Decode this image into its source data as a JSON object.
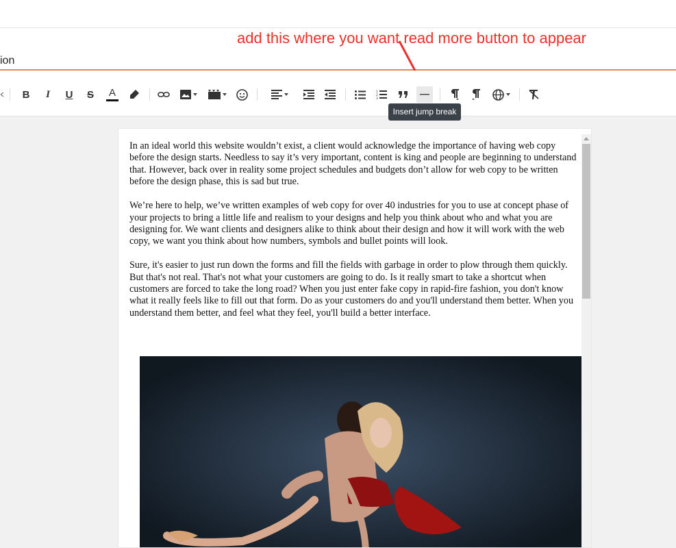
{
  "post": {
    "title_fragment": "ion"
  },
  "annotation": {
    "text": "add this where you want read more button to appear"
  },
  "toolbar": {
    "items": [
      {
        "name": "bold-icon",
        "label": "B"
      },
      {
        "name": "italic-icon",
        "label": "I"
      },
      {
        "name": "underline-icon",
        "label": "U"
      },
      {
        "name": "strikethrough-icon",
        "label": "S"
      },
      {
        "name": "text-color-icon",
        "label": "A"
      },
      {
        "name": "highlight-icon",
        "label": ""
      },
      {
        "name": "link-icon",
        "label": ""
      },
      {
        "name": "insert-image-icon",
        "label": ""
      },
      {
        "name": "insert-video-icon",
        "label": ""
      },
      {
        "name": "emoji-icon",
        "label": ""
      },
      {
        "name": "align-icon",
        "label": ""
      },
      {
        "name": "indent-icon",
        "label": ""
      },
      {
        "name": "outdent-icon",
        "label": ""
      },
      {
        "name": "bulleted-list-icon",
        "label": ""
      },
      {
        "name": "numbered-list-icon",
        "label": ""
      },
      {
        "name": "quote-icon",
        "label": ""
      },
      {
        "name": "jump-break-icon",
        "label": ""
      },
      {
        "name": "ltr-icon",
        "label": ""
      },
      {
        "name": "rtl-icon",
        "label": ""
      },
      {
        "name": "language-icon",
        "label": ""
      },
      {
        "name": "clear-formatting-icon",
        "label": ""
      }
    ],
    "tooltip": "Insert jump break"
  },
  "colors": {
    "annotation": "#e8322a",
    "title_underline": "#f0825a",
    "tooltip_bg": "#3b4148",
    "text_color_bar": "#111111"
  },
  "content": {
    "paragraphs": [
      "In an ideal world this website wouldn’t exist, a client would acknowledge the importance of having web copy before the design starts. Needless to say it’s very important, content is king and people are beginning to understand that. However, back over in reality some project schedules and budgets don’t allow for web copy to be written before the design phase, this is sad but true.",
      "We’re here to help, we’ve written examples of web copy for over 40 industries for you to use at concept phase of your projects to bring a little life and realism to your designs and help you think about who and what you are designing for. We want clients and designers alike to think about their design and how it will work with the web copy, we want you think about how numbers, symbols and bullet points will look.",
      "Sure, it's easier to just run down the forms and fill the fields with garbage in order to plow through them quickly. But that's not real. That's not what your customers are going to do. Is it really smart to take a shortcut when customers are forced to take the long road? When you just enter fake copy in rapid-fire fashion, you don't know what it really feels like to fill out that form. Do as your customers do and you'll understand them better. When you understand them better, and feel what they feel, you'll build a better interface."
    ]
  }
}
